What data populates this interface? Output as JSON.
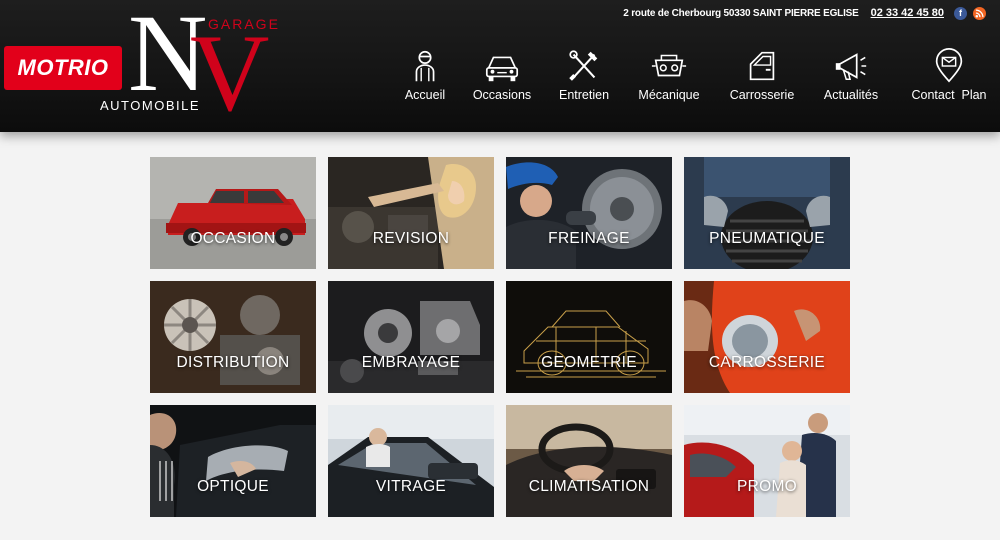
{
  "brand": {
    "motrio": "MOTRIO",
    "logo_n": "N",
    "logo_v": "V",
    "logo_garage": "GARAGE",
    "logo_automobile": "AUTOMOBILE",
    "accent_color": "#e2001a"
  },
  "topbar": {
    "address": "2 route de Cherbourg 50330 SAINT PIERRE EGLISE",
    "phone": "02 33 42 45 80",
    "social": [
      {
        "name": "facebook-icon",
        "glyph": "f",
        "color": "#3b5998"
      },
      {
        "name": "rss-icon",
        "glyph": "◉",
        "color": "#f26522"
      }
    ]
  },
  "nav": [
    {
      "label": "Accueil",
      "icon": "mechanic-icon"
    },
    {
      "label": "Occasions",
      "icon": "car-front-icon"
    },
    {
      "label": "Entretien",
      "icon": "tools-icon"
    },
    {
      "label": "Mécanique",
      "icon": "engine-icon"
    },
    {
      "label": "Carrosserie",
      "icon": "car-door-icon"
    },
    {
      "label": "Actualités",
      "icon": "megaphone-icon"
    },
    {
      "label": "Contact  Plan",
      "icon": "map-pin-mail-icon"
    }
  ],
  "tiles": [
    {
      "label": "OCCASION"
    },
    {
      "label": "REVISION"
    },
    {
      "label": "FREINAGE"
    },
    {
      "label": "PNEUMATIQUE"
    },
    {
      "label": "DISTRIBUTION"
    },
    {
      "label": "EMBRAYAGE"
    },
    {
      "label": "GEOMETRIE"
    },
    {
      "label": "CARROSSERIE"
    },
    {
      "label": "OPTIQUE"
    },
    {
      "label": "VITRAGE"
    },
    {
      "label": "CLIMATISATION"
    },
    {
      "label": "PROMO"
    }
  ]
}
